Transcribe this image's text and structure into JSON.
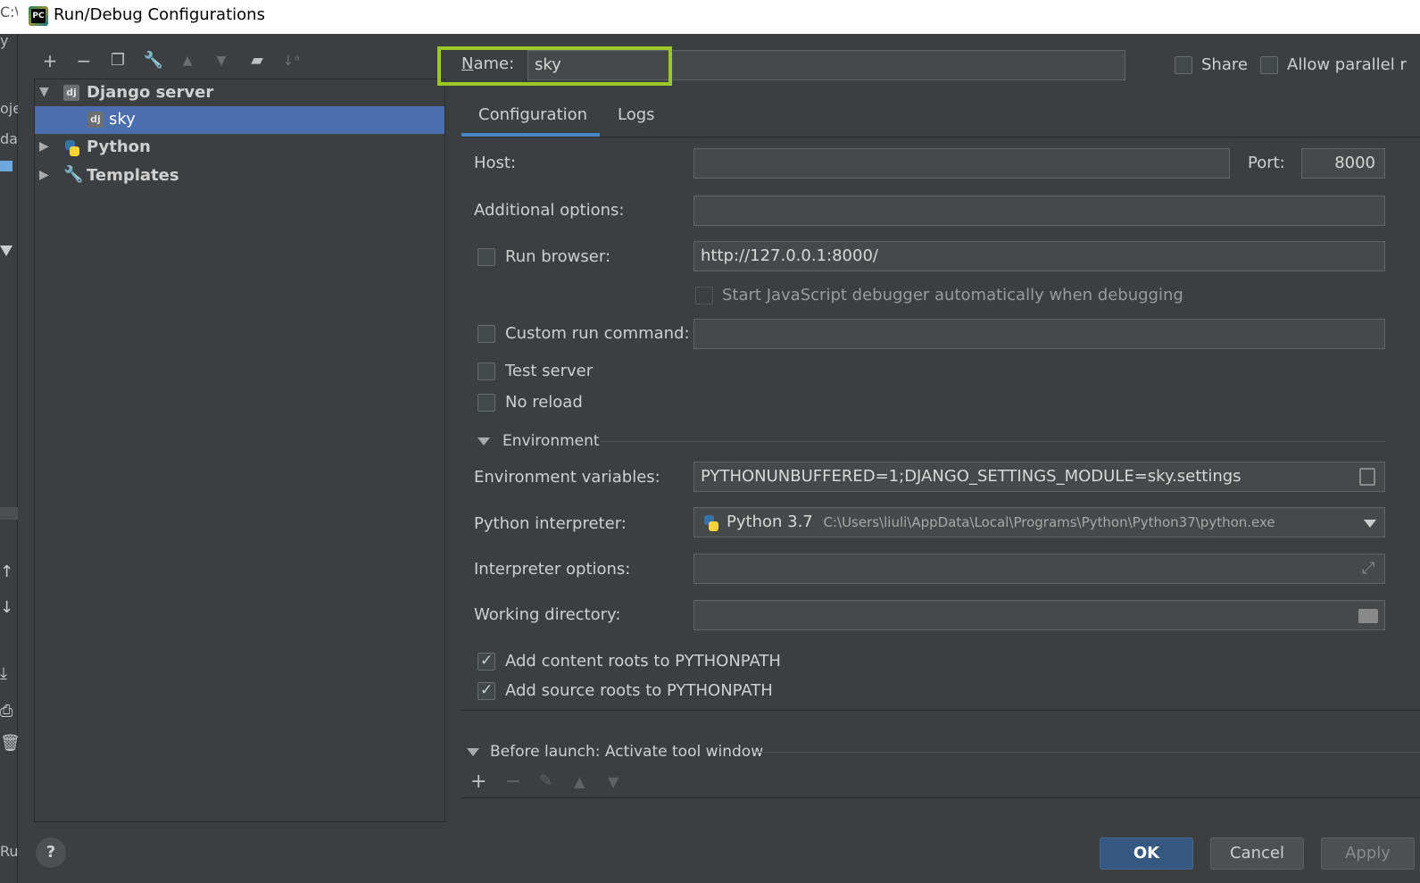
{
  "window": {
    "title": "Run/Debug Configurations",
    "app_icon": "pycharm-icon"
  },
  "ide_strip": {
    "fragments": [
      "C:\\",
      "y",
      "oje",
      "day",
      "Ru"
    ]
  },
  "toolbar": {
    "buttons": [
      "add-icon",
      "remove-icon",
      "copy-icon",
      "wrench-icon",
      "move-up-icon",
      "move-down-icon",
      "new-folder-icon",
      "sort-icon"
    ]
  },
  "tree": {
    "items": [
      {
        "label": "Django server",
        "expanded": true
      },
      {
        "label": "sky",
        "selected": true
      },
      {
        "label": "Python",
        "expanded": false
      },
      {
        "label": "Templates",
        "expanded": false
      }
    ]
  },
  "name": {
    "label": "Name:",
    "value": "sky"
  },
  "share": {
    "label": "Share",
    "checked": false
  },
  "allow_parallel": {
    "label": "Allow parallel r",
    "checked": false
  },
  "tabs": [
    {
      "label": "Configuration",
      "active": true
    },
    {
      "label": "Logs",
      "active": false
    }
  ],
  "config": {
    "host": {
      "label": "Host:",
      "value": ""
    },
    "port": {
      "label": "Port:",
      "value": "8000"
    },
    "additional_options": {
      "label": "Additional options:",
      "value": ""
    },
    "run_browser": {
      "label": "Run browser:",
      "checked": false,
      "value": "http://127.0.0.1:8000/"
    },
    "js_debugger": {
      "label": "Start JavaScript debugger automatically when debugging",
      "checked": false
    },
    "custom_run_command": {
      "label": "Custom run command:",
      "checked": false,
      "value": ""
    },
    "test_server": {
      "label": "Test server",
      "checked": false
    },
    "no_reload": {
      "label": "No reload",
      "checked": false
    },
    "environment_section": "Environment",
    "env_vars": {
      "label": "Environment variables:",
      "value": "PYTHONUNBUFFERED=1;DJANGO_SETTINGS_MODULE=sky.settings"
    },
    "python_interpreter": {
      "label": "Python interpreter:",
      "name": "Python 3.7",
      "path": "C:\\Users\\liuli\\AppData\\Local\\Programs\\Python\\Python37\\python.exe"
    },
    "interpreter_options": {
      "label": "Interpreter options:",
      "value": ""
    },
    "working_directory": {
      "label": "Working directory:",
      "value": ""
    },
    "add_content_roots": {
      "label": "Add content roots to PYTHONPATH",
      "checked": true
    },
    "add_source_roots": {
      "label": "Add source roots to PYTHONPATH",
      "checked": true
    }
  },
  "before_launch": {
    "label": "Before launch: Activate tool window"
  },
  "footer": {
    "help": "?",
    "ok": "OK",
    "cancel": "Cancel",
    "apply": "Apply"
  },
  "colors": {
    "accent": "#4b6eaf",
    "highlight_box": "#9bc826",
    "ok_button": "#365880",
    "background": "#3c3f41"
  }
}
